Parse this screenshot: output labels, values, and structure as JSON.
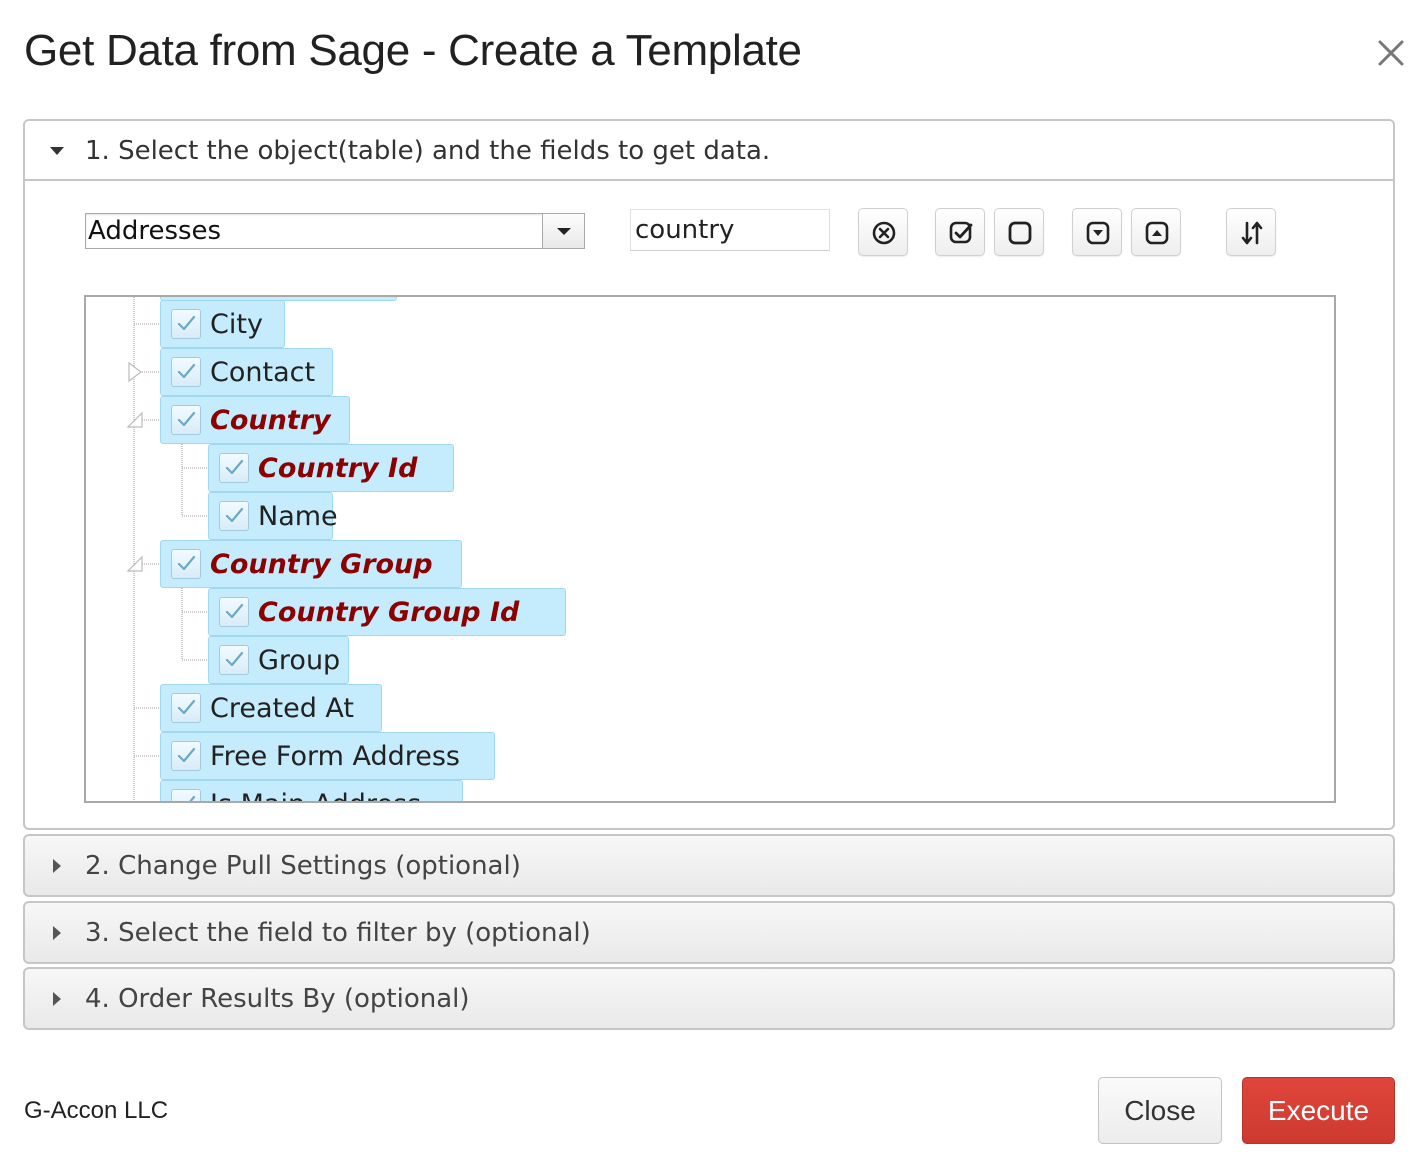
{
  "dialog": {
    "title": "Get Data from Sage - Create a Template",
    "close_icon": "close-icon"
  },
  "sections": [
    {
      "label": "1. Select the object(table) and the fields to get data.",
      "expanded": true
    },
    {
      "label": "2. Change Pull Settings (optional)",
      "expanded": false
    },
    {
      "label": "3. Select the field to filter by (optional)",
      "expanded": false
    },
    {
      "label": "4. Order Results By (optional)",
      "expanded": false
    }
  ],
  "object_select": {
    "value": "Addresses"
  },
  "field_search": {
    "value": "country"
  },
  "toolbar_icons": [
    "clear-search-icon",
    "check-all-icon",
    "uncheck-all-icon",
    "expand-all-icon",
    "collapse-all-icon",
    "sort-icon"
  ],
  "tree": {
    "nodes": [
      {
        "label": "City",
        "level": 0,
        "checked": true,
        "match": false,
        "expander": "none"
      },
      {
        "label": "Contact",
        "level": 0,
        "checked": true,
        "match": false,
        "expander": "collapsed"
      },
      {
        "label": "Country",
        "level": 0,
        "checked": true,
        "match": true,
        "expander": "expanded"
      },
      {
        "label": "Country Id",
        "level": 1,
        "checked": true,
        "match": true,
        "expander": "none"
      },
      {
        "label": "Name",
        "level": 1,
        "checked": true,
        "match": false,
        "expander": "none"
      },
      {
        "label": "Country Group",
        "level": 0,
        "checked": true,
        "match": true,
        "expander": "expanded"
      },
      {
        "label": "Country Group Id",
        "level": 1,
        "checked": true,
        "match": true,
        "expander": "none"
      },
      {
        "label": "Group",
        "level": 1,
        "checked": true,
        "match": false,
        "expander": "none"
      },
      {
        "label": "Created At",
        "level": 0,
        "checked": true,
        "match": false,
        "expander": "none"
      },
      {
        "label": "Free Form Address",
        "level": 0,
        "checked": true,
        "match": false,
        "expander": "none"
      },
      {
        "label": "Is Main Address",
        "level": 0,
        "checked": true,
        "match": false,
        "expander": "none"
      }
    ]
  },
  "footer": {
    "company": "G-Accon LLC",
    "close_label": "Close",
    "execute_label": "Execute"
  },
  "colors": {
    "node_highlight": "#c5ecfc",
    "match_text": "#8b0000",
    "execute": "#d63d33"
  }
}
